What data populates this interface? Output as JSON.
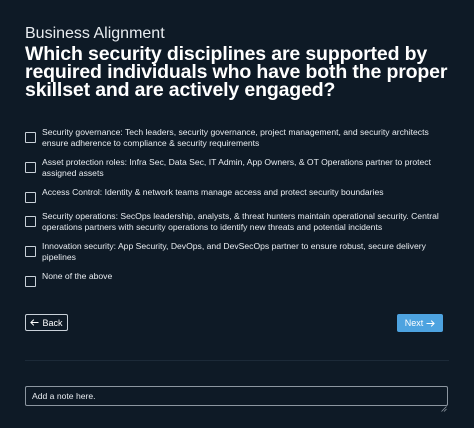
{
  "header": {
    "section": "Business Alignment",
    "question": "Which security disciplines are supported by required individuals who have both the proper skillset and are actively engaged?"
  },
  "options": [
    {
      "label": "Security governance: Tech leaders, security governance, project management, and security architects ensure adherence to compliance & security requirements",
      "checked": false
    },
    {
      "label": "Asset protection roles: Infra Sec, Data Sec, IT Admin, App Owners, & OT Operations partner to protect assigned assets",
      "checked": false
    },
    {
      "label": "Access Control: Identity & network teams manage access and protect security boundaries",
      "checked": false
    },
    {
      "label": "Security operations: SecOps leadership, analysts, & threat hunters maintain operational security. Central operations partners with security operations to identify new threats and potential incidents",
      "checked": false
    },
    {
      "label": "Innovation security: App Security, DevOps, and DevSecOps partner to ensure robust, secure delivery pipelines",
      "checked": false
    },
    {
      "label": "None of the above",
      "checked": false
    }
  ],
  "navigation": {
    "back_label": "Back",
    "next_label": "Next",
    "back_icon": "arrow-left-icon",
    "next_icon": "arrow-right-icon"
  },
  "note": {
    "placeholder": "Add a note here."
  },
  "colors": {
    "background": "#0e1a26",
    "accent": "#4da3e0",
    "text": "#ffffff"
  }
}
